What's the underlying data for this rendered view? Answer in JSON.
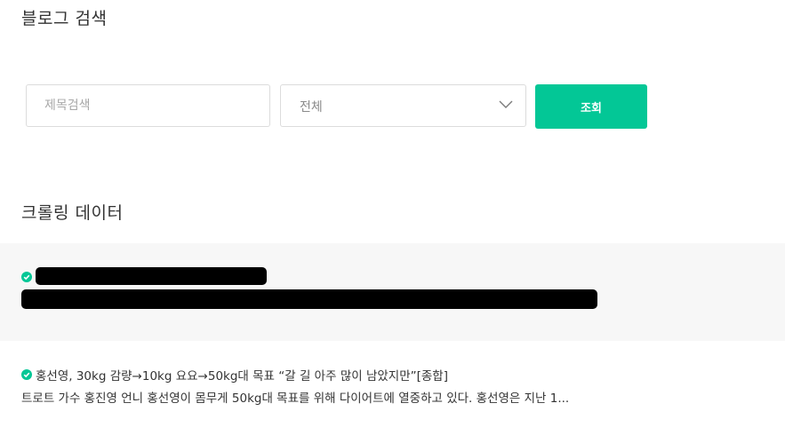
{
  "page": {
    "title": "블로그 검색"
  },
  "search": {
    "placeholder": "제목검색",
    "value": "",
    "category_selected": "전체",
    "submit_label": "조회"
  },
  "crawl": {
    "section_title": "크롤링 데이터",
    "items": [
      {
        "title": "",
        "body": "",
        "redacted": true
      },
      {
        "title": "홍선영, 30kg 감량→10kg 요요→50kg대 목표 “갈 길 아주 많이 남았지만”[종합]",
        "body": "트로트 가수 홍진영 언니 홍선영이 몸무게 50kg대 목표를 위해 다이어트에 열중하고 있다. 홍선영은 지난 1...",
        "redacted": false
      }
    ]
  },
  "colors": {
    "accent": "#03c796",
    "border": "#dcdcdc",
    "highlight_bg": "#f7f7f7",
    "text": "#333333"
  },
  "icons": {
    "check": "check-circle-icon",
    "dropdown": "chevron-down-icon"
  }
}
